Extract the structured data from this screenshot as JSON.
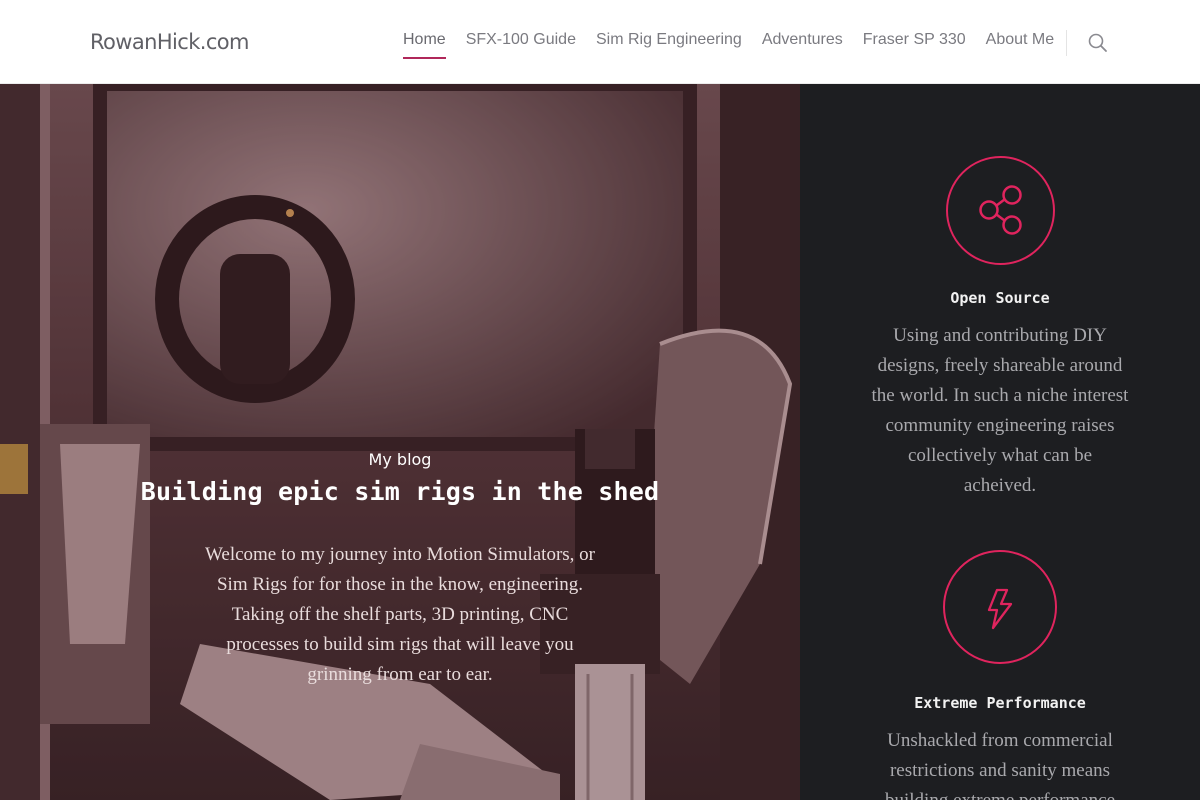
{
  "site": {
    "logo": "RowanHick.com"
  },
  "nav": {
    "items": [
      {
        "label": "Home",
        "active": true
      },
      {
        "label": "SFX-100 Guide",
        "active": false
      },
      {
        "label": "Sim Rig Engineering",
        "active": false
      },
      {
        "label": "Adventures",
        "active": false
      },
      {
        "label": "Fraser SP 330",
        "active": false
      },
      {
        "label": "About Me",
        "active": false
      }
    ],
    "search_icon": "search-icon"
  },
  "hero": {
    "eyebrow": "My blog",
    "title": "Building epic sim rigs in the shed",
    "text": "Welcome to my journey into Motion Simulators, or Sim Rigs for for those in the know, engineering. Taking off the shelf parts, 3D printing, CNC processes to build sim rigs that will leave you grinning from ear to ear."
  },
  "features": [
    {
      "icon": "share-icon",
      "title": "Open Source",
      "text": "Using and contributing DIY designs, freely shareable around the world. In such a niche interest community engineering raises collectively what can be acheived."
    },
    {
      "icon": "lightning-icon",
      "title": "Extreme Performance",
      "text": "Unshackled from commercial restrictions and sanity means building extreme performance"
    }
  ],
  "colors": {
    "accent": "#e0245e",
    "nav_underline": "#b0285a",
    "sidebar_bg": "#1d1e21"
  }
}
